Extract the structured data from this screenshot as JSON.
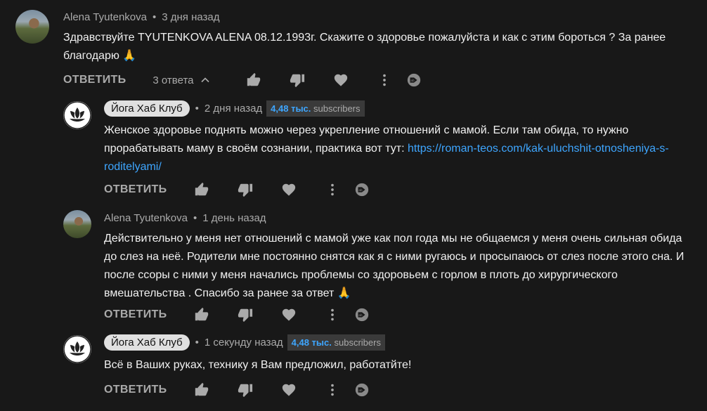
{
  "comments": [
    {
      "author": "Alena Tyutenkova",
      "time": "3 дня назад",
      "text": "Здравствуйте TYUTENKOVA ALENA 08.12.1993г. Скажите о здоровье пожалуйста и как с этим бороться ? За ранее благодарю 🙏",
      "reply_label": "ОТВЕТИТЬ",
      "replies_count": "3 ответа"
    }
  ],
  "replies": [
    {
      "author": "Йога Хаб Клуб",
      "time": "2 дня назад",
      "subs_num": "4,48 тыс.",
      "subs_label": "subscribers",
      "text_before": "Женское здоровье поднять можно через укрепление отношений с мамой. Если там обида, то нужно прорабатывать маму в своём сознании, практика вот тут: ",
      "link": "https://roman-teos.com/kak-uluchshit-otnosheniya-s-roditelyami/",
      "reply_label": "ОТВЕТИТЬ"
    },
    {
      "author": "Alena Tyutenkova",
      "time": "1 день назад",
      "text": "Действительно у меня нет отношений с мамой уже как пол года мы не общаемся у меня очень сильная обида до слез на неё. Родители мне постоянно снятся как я с ними ругаюсь и  просыпаюсь от слез после этого сна. И после ссоры с ними у меня начались проблемы со здоровьем с горлом в плоть до хирургического вмешательства . Спасибо за ранее за ответ 🙏",
      "reply_label": "ОТВЕТИТЬ"
    },
    {
      "author": "Йога Хаб Клуб",
      "time": "1 секунду назад",
      "subs_num": "4,48 тыс.",
      "subs_label": "subscribers",
      "text": "Всё в Ваших руках, технику я Вам предложил, работатйте!",
      "reply_label": "ОТВЕТИТЬ"
    }
  ],
  "separator": "•",
  "icons": [
    "thumbs-up-icon",
    "thumbs-down-icon",
    "heart-icon",
    "more-vert-icon",
    "translate-icon",
    "chevron-up-icon"
  ],
  "colors": {
    "background": "#181818",
    "link": "#3ea6ff",
    "muted": "#aaaaaa"
  }
}
